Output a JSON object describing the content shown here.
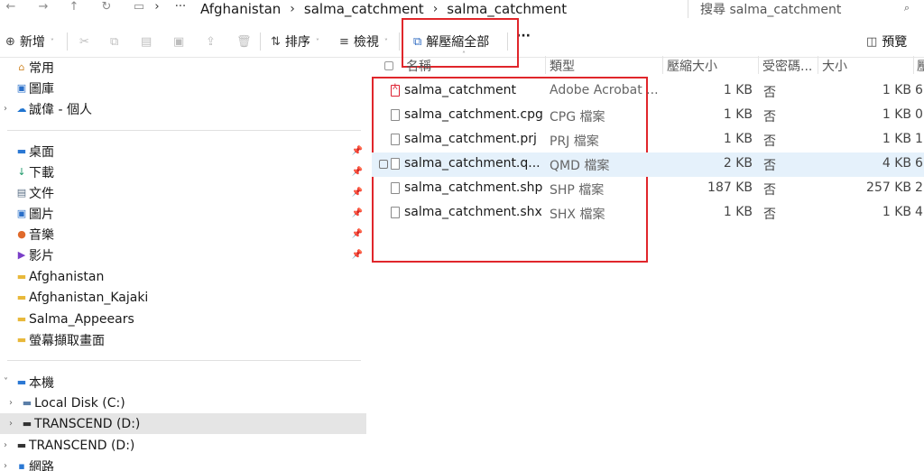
{
  "nav": {
    "back": "←",
    "forward": "→",
    "up": "↑",
    "refresh": "↻",
    "pc": "▭",
    "more": "···",
    "breadcrumbs": [
      "Afghanistan",
      "salma_catchment",
      "salma_catchment"
    ],
    "search_placeholder": "搜尋 salma_catchment"
  },
  "toolbar": {
    "new_label": "新增",
    "sort_label": "排序",
    "view_label": "檢視",
    "extract_all_label": "解壓縮全部",
    "more_label": "···",
    "preview_label": "預覽"
  },
  "sidebar": {
    "quick": [
      {
        "label": "常用",
        "icon": "home-icon"
      },
      {
        "label": "圖庫",
        "icon": "gallery-icon"
      },
      {
        "label": "誠偉 - 個人",
        "icon": "onedrive-icon"
      }
    ],
    "pinned": [
      {
        "label": "桌面",
        "icon": "desktop-icon"
      },
      {
        "label": "下載",
        "icon": "download-icon"
      },
      {
        "label": "文件",
        "icon": "document-icon"
      },
      {
        "label": "圖片",
        "icon": "pictures-icon"
      },
      {
        "label": "音樂",
        "icon": "music-icon"
      },
      {
        "label": "影片",
        "icon": "video-icon"
      }
    ],
    "folders": [
      "Afghanistan",
      "Afghanistan_Kajaki",
      "Salma_Appeears",
      "螢幕擷取畫面"
    ],
    "devices": [
      {
        "label": "本機",
        "icon": "computer-icon"
      },
      {
        "label": "Local Disk (C:)",
        "icon": "disk-icon"
      },
      {
        "label": "TRANSCEND (D:)",
        "icon": "usb-drive-icon"
      },
      {
        "label": "TRANSCEND (D:)",
        "icon": "usb-drive-icon"
      },
      {
        "label": "網路",
        "icon": "network-icon"
      }
    ]
  },
  "columns": {
    "name": "名稱",
    "type": "類型",
    "compressed_size": "壓縮大小",
    "password": "受密碼...",
    "size": "大小",
    "extra": "壓"
  },
  "files": [
    {
      "name": "salma_catchment",
      "type": "Adobe Acrobat ...",
      "compressed_size": "1 KB",
      "password": "否",
      "size": "1 KB",
      "extra": "6",
      "icon": "pdf-file-icon"
    },
    {
      "name": "salma_catchment.cpg",
      "type": "CPG 檔案",
      "compressed_size": "1 KB",
      "password": "否",
      "size": "1 KB",
      "extra": "0",
      "icon": "file-icon"
    },
    {
      "name": "salma_catchment.prj",
      "type": "PRJ 檔案",
      "compressed_size": "1 KB",
      "password": "否",
      "size": "1 KB",
      "extra": "1",
      "icon": "file-icon"
    },
    {
      "name": "salma_catchment.q...",
      "type": "QMD 檔案",
      "compressed_size": "2 KB",
      "password": "否",
      "size": "4 KB",
      "extra": "6",
      "icon": "file-icon"
    },
    {
      "name": "salma_catchment.shp",
      "type": "SHP 檔案",
      "compressed_size": "187 KB",
      "password": "否",
      "size": "257 KB",
      "extra": "2",
      "icon": "file-icon"
    },
    {
      "name": "salma_catchment.shx",
      "type": "SHX 檔案",
      "compressed_size": "1 KB",
      "password": "否",
      "size": "1 KB",
      "extra": "4",
      "icon": "file-icon"
    }
  ],
  "colors": {
    "annotation_red": "#e0262b",
    "selected_row": "#e5f1fb",
    "selected_nav": "#e5e5e5"
  }
}
